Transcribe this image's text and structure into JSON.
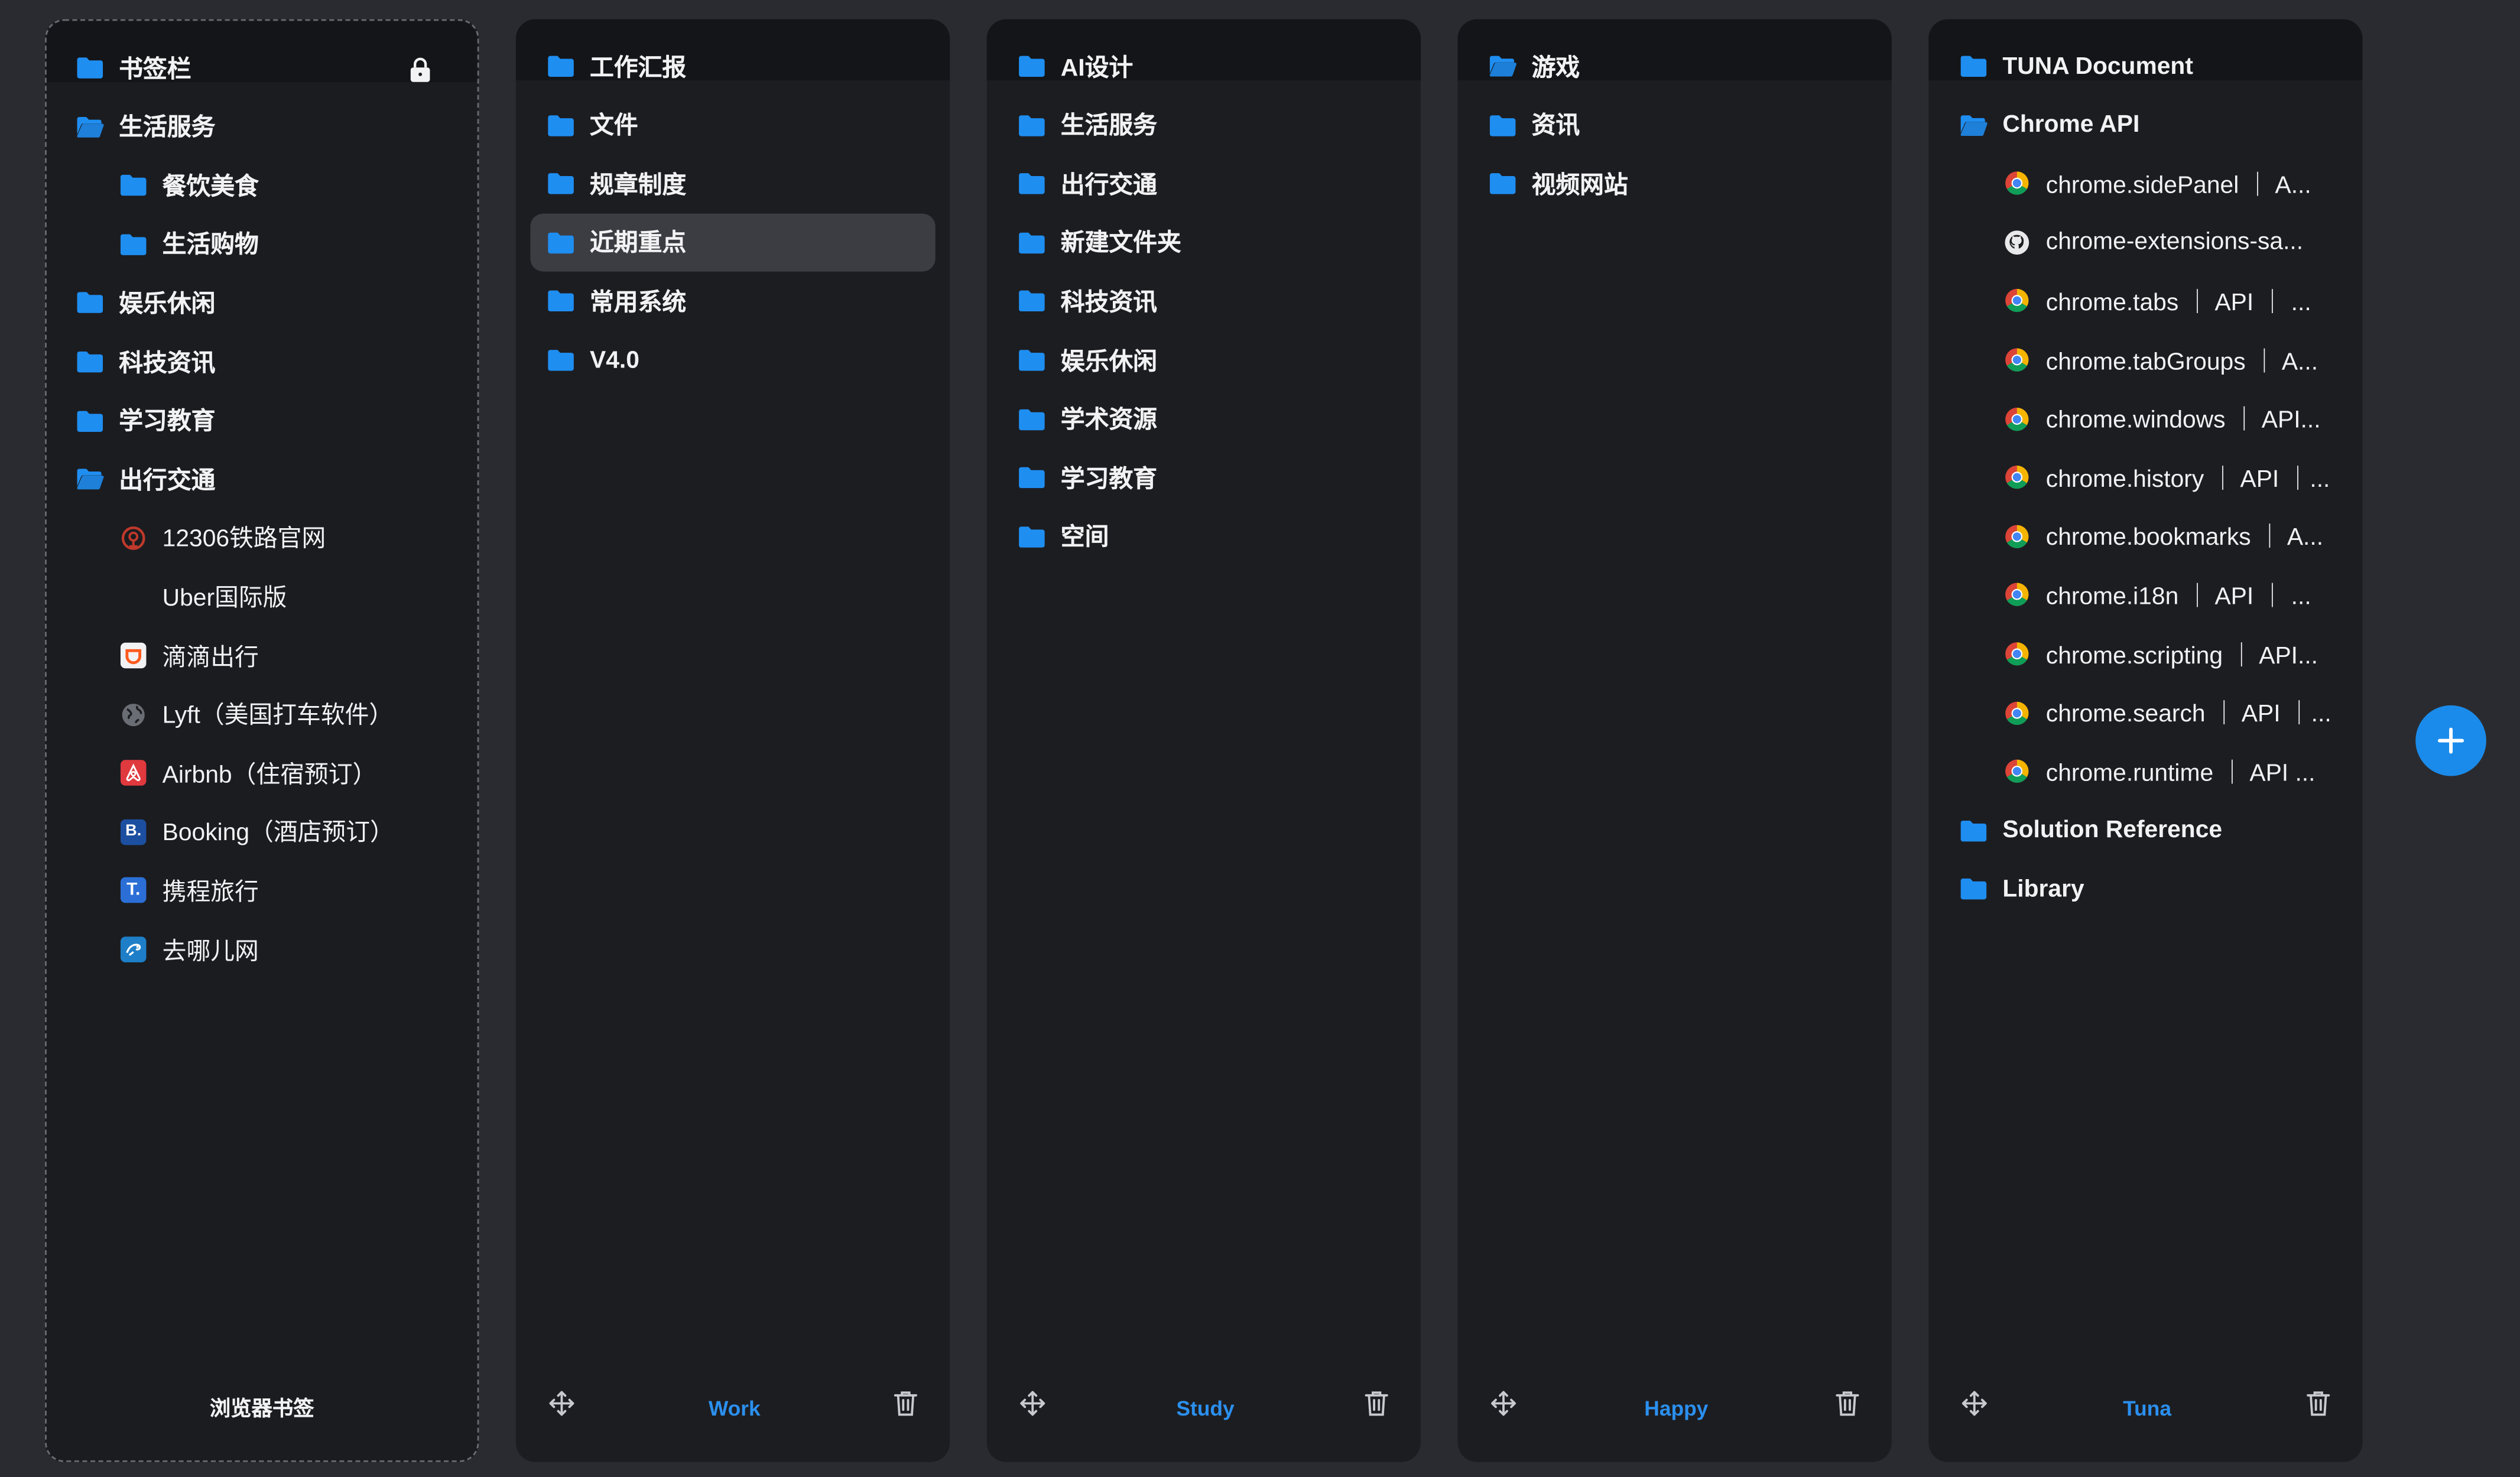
{
  "colors": {
    "accent": "#2b90ef",
    "folder": "#1f8ef1",
    "panel": "#1c1d21",
    "background": "#2a2b30",
    "fab": "#1a8bea"
  },
  "columns": [
    {
      "items": [
        {
          "label": "书签栏",
          "type": "folder"
        },
        {
          "label": "生活服务",
          "type": "folder-open"
        },
        {
          "label": "餐饮美食",
          "type": "folder",
          "indent": 1
        },
        {
          "label": "生活购物",
          "type": "folder",
          "indent": 1
        },
        {
          "label": "娱乐休闲",
          "type": "folder"
        },
        {
          "label": "科技资讯",
          "type": "folder"
        },
        {
          "label": "学习教育",
          "type": "folder"
        },
        {
          "label": "出行交通",
          "type": "folder-open"
        },
        {
          "label": "12306铁路官网",
          "type": "link",
          "icon": "railway-icon",
          "indent": 1
        },
        {
          "label": "Uber国际版",
          "type": "link",
          "icon": "none",
          "indent": 1
        },
        {
          "label": "滴滴出行",
          "type": "link",
          "icon": "didi-icon",
          "indent": 1
        },
        {
          "label": "Lyft（美国打车软件）",
          "type": "link",
          "icon": "globe-icon",
          "indent": 1
        },
        {
          "label": "Airbnb（住宿预订）",
          "type": "link",
          "icon": "airbnb-icon",
          "indent": 1
        },
        {
          "label": "Booking（酒店预订）",
          "type": "link",
          "icon": "booking-icon",
          "indent": 1
        },
        {
          "label": "携程旅行",
          "type": "link",
          "icon": "trip-icon",
          "indent": 1
        },
        {
          "label": "去哪儿网",
          "type": "link",
          "icon": "qunar-icon",
          "indent": 1
        }
      ],
      "footer": "浏览器书签"
    },
    {
      "items": [
        {
          "label": "工作汇报",
          "type": "folder"
        },
        {
          "label": "文件",
          "type": "folder"
        },
        {
          "label": "规章制度",
          "type": "folder"
        },
        {
          "label": "近期重点",
          "type": "folder",
          "selected": true
        },
        {
          "label": "常用系统",
          "type": "folder"
        },
        {
          "label": "V4.0",
          "type": "folder"
        }
      ],
      "footer": "Work"
    },
    {
      "items": [
        {
          "label": "AI设计",
          "type": "folder"
        },
        {
          "label": "生活服务",
          "type": "folder"
        },
        {
          "label": "出行交通",
          "type": "folder"
        },
        {
          "label": "新建文件夹",
          "type": "folder"
        },
        {
          "label": "科技资讯",
          "type": "folder"
        },
        {
          "label": "娱乐休闲",
          "type": "folder"
        },
        {
          "label": "学术资源",
          "type": "folder"
        },
        {
          "label": "学习教育",
          "type": "folder"
        },
        {
          "label": "空间",
          "type": "folder"
        }
      ],
      "footer": "Study"
    },
    {
      "items": [
        {
          "label": "游戏",
          "type": "folder-open"
        },
        {
          "label": "资讯",
          "type": "folder"
        },
        {
          "label": "视频网站",
          "type": "folder"
        }
      ],
      "footer": "Happy"
    },
    {
      "items": [
        {
          "label": "TUNA Document",
          "type": "folder"
        },
        {
          "label": "Chrome API",
          "type": "folder-open"
        },
        {
          "label": "chrome.sidePanel ｜ A...",
          "type": "link",
          "icon": "chrome-icon",
          "indent": 1
        },
        {
          "label": "chrome-extensions-sa...",
          "type": "link",
          "icon": "github-icon",
          "indent": 1
        },
        {
          "label": "chrome.tabs ｜ API ｜ ...",
          "type": "link",
          "icon": "chrome-icon",
          "indent": 1
        },
        {
          "label": "chrome.tabGroups ｜ A...",
          "type": "link",
          "icon": "chrome-icon",
          "indent": 1
        },
        {
          "label": "chrome.windows ｜ API...",
          "type": "link",
          "icon": "chrome-icon",
          "indent": 1
        },
        {
          "label": "chrome.history ｜ API ｜...",
          "type": "link",
          "icon": "chrome-icon",
          "indent": 1
        },
        {
          "label": "chrome.bookmarks ｜ A...",
          "type": "link",
          "icon": "chrome-icon",
          "indent": 1
        },
        {
          "label": "chrome.i18n ｜ API ｜ ...",
          "type": "link",
          "icon": "chrome-icon",
          "indent": 1
        },
        {
          "label": "chrome.scripting ｜ API...",
          "type": "link",
          "icon": "chrome-icon",
          "indent": 1
        },
        {
          "label": "chrome.search ｜ API ｜...",
          "type": "link",
          "icon": "chrome-icon",
          "indent": 1
        },
        {
          "label": "chrome.runtime ｜ API ...",
          "type": "link",
          "icon": "chrome-icon",
          "indent": 1
        },
        {
          "label": "Solution Reference",
          "type": "folder"
        },
        {
          "label": "Library",
          "type": "folder"
        }
      ],
      "footer": "Tuna"
    }
  ]
}
